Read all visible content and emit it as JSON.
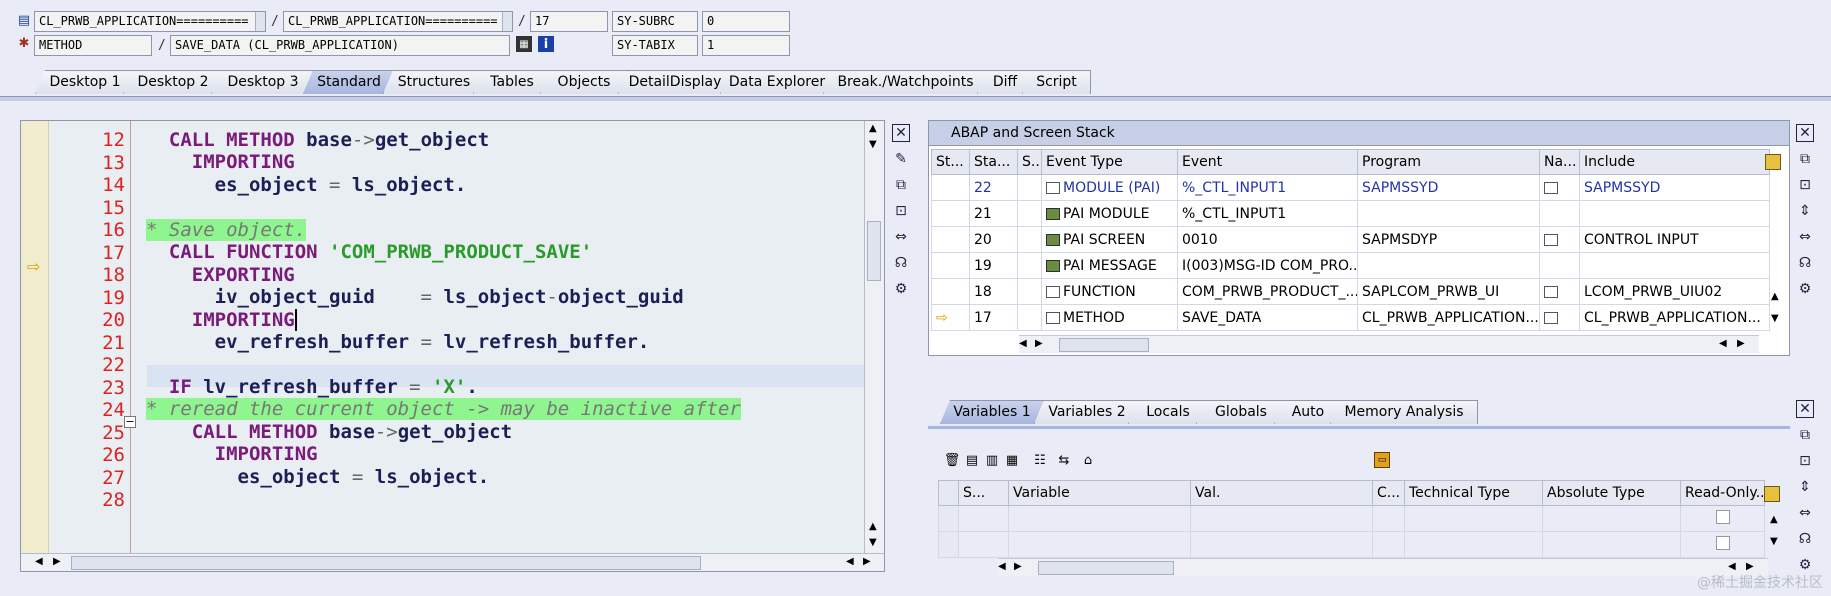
{
  "top": {
    "row1": {
      "field1": "CL_PRWB_APPLICATION==========",
      "field2": "CL_PRWB_APPLICATION==========",
      "field3": "17",
      "sys_label": "SY-SUBRC",
      "sys_value": "0"
    },
    "row2": {
      "field1": "METHOD",
      "field2": "SAVE_DATA (CL_PRWB_APPLICATION)",
      "sys_label": "SY-TABIX",
      "sys_value": "1"
    },
    "sep": "/"
  },
  "tabs": [
    "Desktop 1",
    "Desktop 2",
    "Desktop 3",
    "Standard",
    "Structures",
    "Tables",
    "Objects",
    "DetailDisplay",
    "Data Explorer",
    "Break./Watchpoints",
    "Diff",
    "Script"
  ],
  "editor": {
    "line_numbers": [
      "12",
      "13",
      "14",
      "15",
      "16",
      "17",
      "18",
      "19",
      "20",
      "21",
      "22",
      "23",
      "24",
      "25",
      "26",
      "27",
      "28"
    ],
    "current_line_index": 5
  },
  "stack": {
    "title": "ABAP and Screen Stack",
    "columns": [
      "St...",
      "Sta...",
      "S..",
      "Event Type",
      "Event",
      "Program",
      "Na...",
      "Include"
    ],
    "rows": [
      {
        "stack": "22",
        "type": "MODULE (PAI)",
        "event": "%_CTL_INPUT1",
        "program": "SAPMSSYD",
        "include": "SAPMSSYD"
      },
      {
        "stack": "21",
        "type": "PAI MODULE",
        "event": "%_CTL_INPUT1",
        "program": "",
        "include": ""
      },
      {
        "stack": "20",
        "type": "PAI SCREEN",
        "event": "0010",
        "program": "SAPMSDYP",
        "include": "CONTROL INPUT"
      },
      {
        "stack": "19",
        "type": "PAI MESSAGE",
        "event": "I(003)MSG-ID COM_PRO...",
        "program": "",
        "include": ""
      },
      {
        "stack": "18",
        "type": "FUNCTION",
        "event": "COM_PRWB_PRODUCT_...",
        "program": "SAPLCOM_PRWB_UI",
        "include": "LCOM_PRWB_UIU02"
      },
      {
        "stack": "17",
        "type": "METHOD",
        "event": "SAVE_DATA",
        "program": "CL_PRWB_APPLICATION...",
        "include": "CL_PRWB_APPLICATION..."
      }
    ]
  },
  "vars": {
    "tabs": [
      "Variables 1",
      "Variables 2",
      "Locals",
      "Globals",
      "Auto",
      "Memory Analysis"
    ],
    "columns": [
      "S...",
      "Variable",
      "Val.",
      "C...",
      "Technical Type",
      "Absolute Type",
      "Read-Only..."
    ]
  },
  "watermark": "@稀土掘金技术社区",
  "colors": {
    "accent": "#a7b6e0",
    "comment_bg": "#8ff58f",
    "keyword": "#7a1a7a",
    "string": "#2a9a2a",
    "line_number": "#dd2222"
  }
}
